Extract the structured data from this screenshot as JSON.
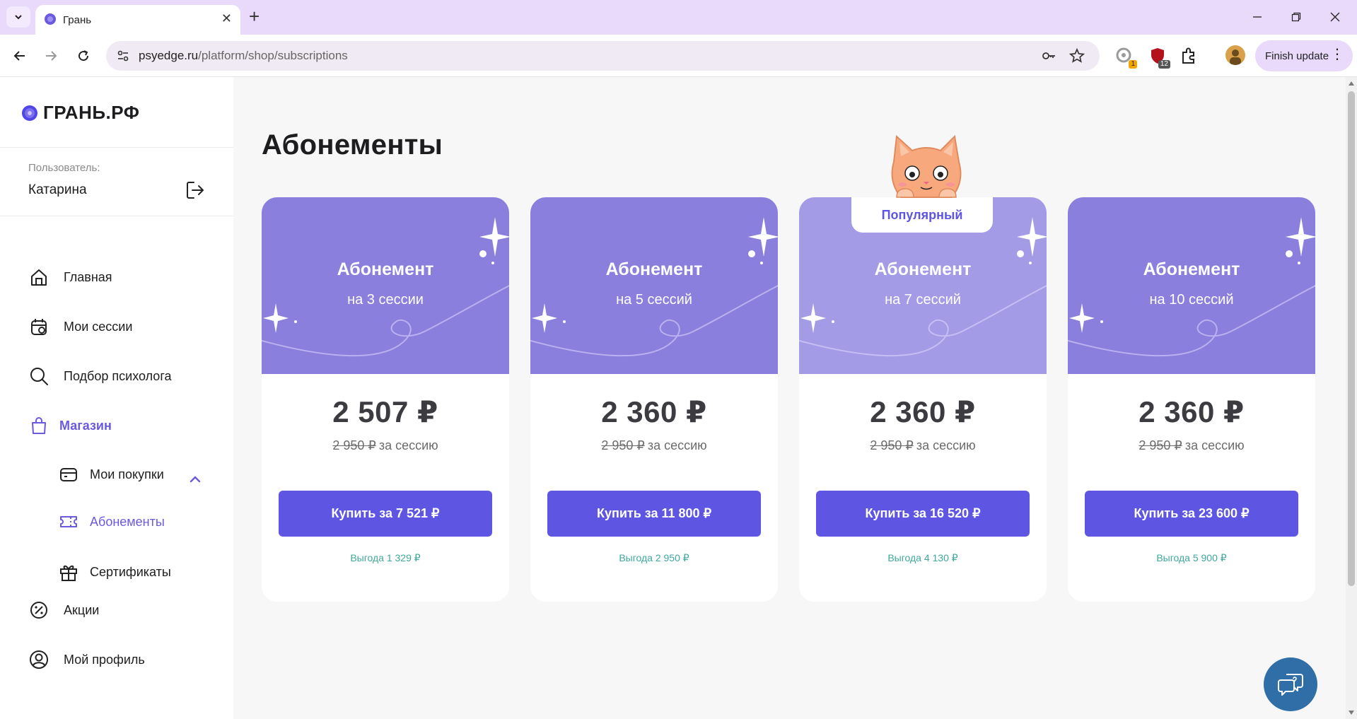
{
  "browser": {
    "tab_title": "Грань",
    "url_domain": "psyedge.ru",
    "url_path": "/platform/shop/subscriptions",
    "finish_update_label": "Finish update",
    "ext_badge_1": "1",
    "ext_badge_2": "12"
  },
  "sidebar": {
    "logo_text": "ГРАНЬ.РФ",
    "user_label": "Пользователь:",
    "user_name": "Катарина",
    "nav": {
      "home": "Главная",
      "sessions": "Мои сессии",
      "psychologist": "Подбор психолога",
      "shop": "Магазин",
      "purchases": "Мои покупки",
      "subscriptions": "Абонементы",
      "certificates": "Сертификаты",
      "promotions": "Акции",
      "profile": "Мой профиль"
    }
  },
  "main": {
    "title": "Абонементы",
    "popular_label": "Популярный",
    "cards": [
      {
        "title": "Абонемент",
        "subtitle": "на 3 сессии",
        "price": "2 507 ₽",
        "old_price": "2 950 ₽",
        "per_session": "за сессию",
        "button": "Купить за 7 521 ₽",
        "savings": "Выгода 1 329 ₽"
      },
      {
        "title": "Абонемент",
        "subtitle": "на 5 сессий",
        "price": "2 360 ₽",
        "old_price": "2 950 ₽",
        "per_session": "за сессию",
        "button": "Купить за 11 800 ₽",
        "savings": "Выгода 2 950 ₽"
      },
      {
        "title": "Абонемент",
        "subtitle": "на 7 сессий",
        "price": "2 360 ₽",
        "old_price": "2 950 ₽",
        "per_session": "за сессию",
        "button": "Купить за 16 520 ₽",
        "savings": "Выгода 4 130 ₽"
      },
      {
        "title": "Абонемент",
        "subtitle": "на 10 сессий",
        "price": "2 360 ₽",
        "old_price": "2 950 ₽",
        "per_session": "за сессию",
        "button": "Купить за 23 600 ₽",
        "savings": "Выгода 5 900 ₽"
      }
    ]
  },
  "colors": {
    "accent": "#5e55e2",
    "card_header": "#8a7fdc",
    "card_header_popular": "#a49be6",
    "savings": "#3fa89b",
    "chat_button": "#2f6ea7"
  },
  "icons": {
    "home": "home-icon",
    "sessions": "calendar-icon",
    "psychologist": "search-icon",
    "shop": "shopping-bag-icon",
    "purchases": "wallet-icon",
    "subscriptions": "ticket-icon",
    "certificates": "gift-icon",
    "promotions": "discount-icon",
    "profile": "user-circle-icon",
    "logout": "logout-icon",
    "chat": "chat-bubbles-icon"
  }
}
